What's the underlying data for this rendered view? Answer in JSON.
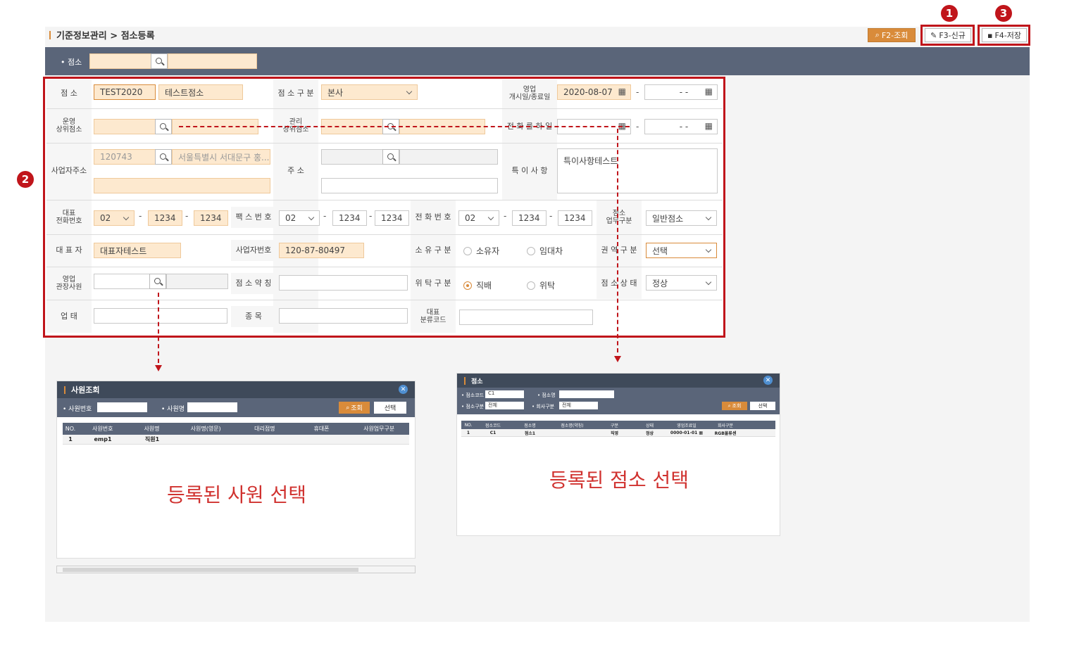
{
  "breadcrumb": "기준정보관리 > 점소등록",
  "toolbar": {
    "search": "F2-조회",
    "new": "F3-신규",
    "save": "F4-저장"
  },
  "markers": {
    "one": "1",
    "two": "2",
    "three": "3"
  },
  "searchbar": {
    "label": "• 점소"
  },
  "form": {
    "store_label": "점 소",
    "store_code": "TEST2020",
    "store_name": "테스트점소",
    "store_type_label": "점 소 구 분",
    "store_type": "본사",
    "open_label": "영업\n개시일/종료일",
    "open_date": "2020-08-07",
    "end_date": "- -",
    "parent_label": "운영\n상위점소",
    "mgmt_parent_label": "관리\n상위점소",
    "date2_label": "전 화 를 하 일",
    "date2_end": "- -",
    "biz_addr_label": "사업자주소",
    "zip": "120743",
    "biz_addr": "서울특별시 서대문구 홍...",
    "addr_label": "주 소",
    "note_label": "특 이 사 항",
    "note": "특이사항테스트",
    "rep_phone_label": "대표\n전화번호",
    "rep_phone": [
      "02",
      "1234",
      "1234"
    ],
    "fax_label": "팩 스 번 호",
    "fax": [
      "02",
      "1234",
      "1234"
    ],
    "phone_label": "전 화 번 호",
    "phone": [
      "02",
      "1234",
      "1234"
    ],
    "biz_type_label": "점소\n업무구분",
    "biz_type": "일반점소",
    "rep_label": "대 표 자",
    "rep": "대표자테스트",
    "bizno_label": "사업자번호",
    "bizno": "120-87-80497",
    "own_label": "소 유 구 분",
    "own_opt1": "소유자",
    "own_opt2": "임대차",
    "region_label": "권 역 구 분",
    "region": "선택",
    "sales_mgr_label": "영업\n관장사원",
    "short_label": "점 소 약 칭",
    "trust_label": "위 탁 구 분",
    "trust_opt1": "직배",
    "trust_opt2": "위탁",
    "status_label": "점 소 상 태",
    "status": "정상",
    "biz_cond_label": "업 태",
    "item_label": "종 목",
    "class_label": "대표\n분류코드"
  },
  "emp_popup": {
    "title": "사원조회",
    "f1": "• 사원번호",
    "f2": "• 사원명",
    "search": "조회",
    "select": "선택",
    "cols": [
      "NO.",
      "사원번호",
      "사원명",
      "사원명(영문)",
      "대리점명",
      "휴대폰",
      "사원업무구분"
    ],
    "row": [
      "1",
      "emp1",
      "직원1",
      "",
      "",
      "",
      ""
    ],
    "caption": "등록된 사원 선택"
  },
  "store_popup": {
    "title": "점소",
    "f1": "• 점소코드",
    "f1v": "C1",
    "f2": "• 점소명",
    "f3": "• 점소구분",
    "f3v": "전체",
    "f4": "• 회사구분",
    "f4v": "전체",
    "search": "조회",
    "select": "선택",
    "cols": [
      "NO.",
      "점소코드",
      "점소명",
      "점소명(약칭)",
      "구분",
      "상태",
      "영업조료일",
      "회사구분"
    ],
    "row": [
      "1",
      "C1",
      "점소1",
      "",
      "직영",
      "정상",
      "0000-01-01 ▦",
      "RGB물류센"
    ],
    "caption": "등록된 점소 선택"
  }
}
